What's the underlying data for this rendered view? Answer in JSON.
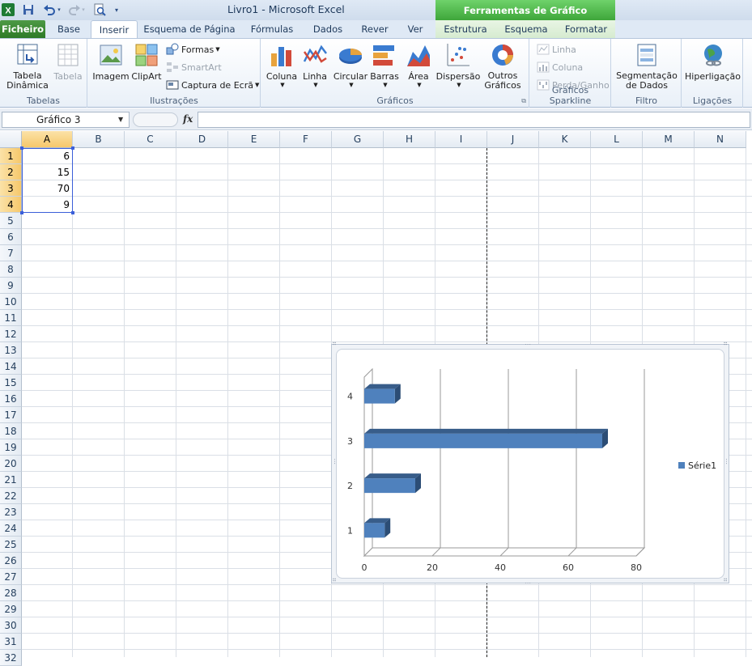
{
  "app": {
    "title": "Livro1  -  Microsoft Excel",
    "tools_header": "Ferramentas de Gráfico"
  },
  "tabs": [
    {
      "label": "Ficheiro"
    },
    {
      "label": "Base"
    },
    {
      "label": "Inserir"
    },
    {
      "label": "Esquema de Página"
    },
    {
      "label": "Fórmulas"
    },
    {
      "label": "Dados"
    },
    {
      "label": "Rever"
    },
    {
      "label": "Ver"
    },
    {
      "label": "Estrutura"
    },
    {
      "label": "Esquema"
    },
    {
      "label": "Formatar"
    }
  ],
  "ribbon": {
    "groups": {
      "tabelas": "Tabelas",
      "ilustracoes": "Ilustrações",
      "graficos": "Gráficos",
      "sparkline": "Gráficos Sparkline",
      "filtro": "Filtro",
      "ligacoes": "Ligações"
    },
    "buttons": {
      "tabela_dinamica": "Tabela\nDinâmica",
      "tabela": "Tabela",
      "imagem": "Imagem",
      "clipart": "ClipArt",
      "formas": "Formas",
      "smartart": "SmartArt",
      "captura": "Captura de Ecrã",
      "coluna": "Coluna",
      "linha": "Linha",
      "circular": "Circular",
      "barras": "Barras",
      "area": "Área",
      "dispersao": "Dispersão",
      "outros": "Outros\nGráficos",
      "spark_linha": "Linha",
      "spark_coluna": "Coluna",
      "spark_perda": "Perda/Ganho",
      "segmentacao": "Segmentação\nde Dados",
      "hiperligacao": "Hiperligação"
    }
  },
  "formula_bar": {
    "name_box": "Gráfico 3",
    "fx": "fx",
    "formula": ""
  },
  "grid": {
    "columns": [
      "A",
      "B",
      "C",
      "D",
      "E",
      "F",
      "G",
      "H",
      "I",
      "J",
      "K",
      "L",
      "M",
      "N"
    ],
    "rows": [
      "1",
      "2",
      "3",
      "4",
      "5",
      "6",
      "7",
      "8",
      "9",
      "10",
      "11",
      "12",
      "13",
      "14",
      "15",
      "16",
      "17",
      "18",
      "19",
      "20",
      "21",
      "22",
      "23",
      "24",
      "25",
      "26",
      "27",
      "28",
      "29",
      "30",
      "31",
      "32"
    ],
    "cells": {
      "A1": "6",
      "A2": "15",
      "A3": "70",
      "A4": "9"
    }
  },
  "colors": {
    "bar_front": "#4f81bd",
    "bar_top": "#385d8a",
    "bar_side": "#2c4d75",
    "file_tab": "#3d8b35"
  },
  "chart_data": {
    "type": "bar",
    "orientation": "horizontal",
    "three_d": true,
    "categories": [
      "1",
      "2",
      "3",
      "4"
    ],
    "series": [
      {
        "name": "Série1",
        "values": [
          6,
          15,
          70,
          9
        ]
      }
    ],
    "xlim": [
      0,
      80
    ],
    "x_ticks": [
      "0",
      "20",
      "40",
      "60",
      "80"
    ],
    "grid": true,
    "legend": "right"
  }
}
